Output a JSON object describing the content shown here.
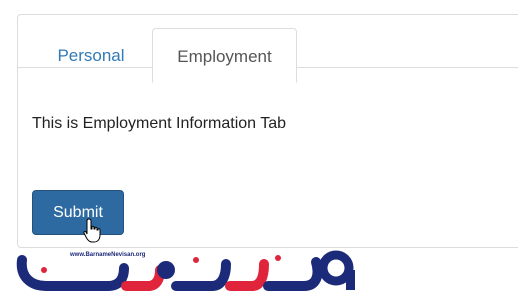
{
  "tabs": [
    {
      "label": "Personal",
      "active": false
    },
    {
      "label": "Employment",
      "active": true
    }
  ],
  "content": {
    "text": "This is Employment Information Tab"
  },
  "submit": {
    "label": "Submit"
  },
  "watermark": {
    "url": "www.BarnameNevisan.org"
  },
  "colors": {
    "link": "#337ab7",
    "button": "#2d6aa1",
    "logo_blue": "#1c2a7a",
    "logo_red": "#e0243c"
  }
}
